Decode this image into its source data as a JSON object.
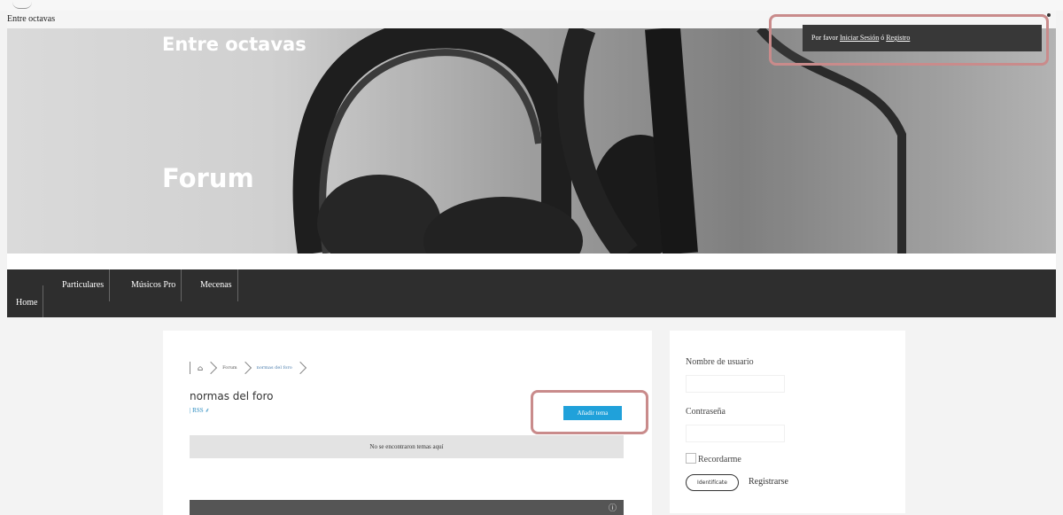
{
  "site": {
    "name": "Entre octavas"
  },
  "hero": {
    "title": "Entre octavas",
    "page_title": "Forum"
  },
  "login_notice": {
    "prefix": "Por favor ",
    "login_link": "Iniciar Sesión",
    "middle": " ó ",
    "register_link": "Registro"
  },
  "nav": {
    "items": [
      {
        "label": "Home"
      },
      {
        "label": "Particulares"
      },
      {
        "label": "Músicos Pro"
      },
      {
        "label": "Mecenas"
      }
    ]
  },
  "breadcrumb": {
    "home_icon": "home-icon",
    "forum": "Forum",
    "current": "normas del foro"
  },
  "forum": {
    "title": "normas del foro",
    "rss": "| RSS",
    "rss_icon": "rss-icon",
    "add_topic": "Añadir tema",
    "empty_message": "No se encontraron temas aquí",
    "info_icon": "ⓘ"
  },
  "login_form": {
    "username_label": "Nombre de usuario",
    "password_label": "Contraseña",
    "remember_label": "Recordarme",
    "login_button": "Identifícate",
    "register_link": "Registrarse"
  },
  "colors": {
    "accent": "#159cd8",
    "nav_bg": "#2e2e2e",
    "highlight": "#c98b8b"
  }
}
